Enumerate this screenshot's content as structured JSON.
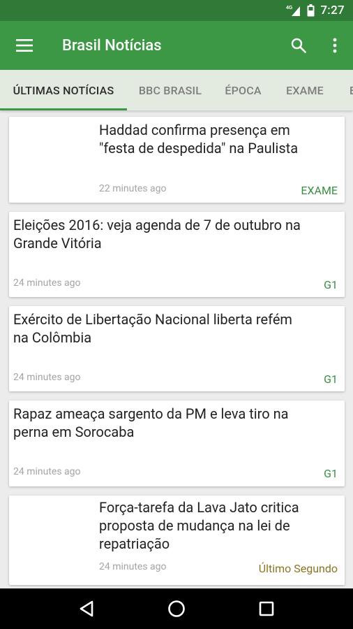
{
  "status": {
    "network": "4G",
    "time": "7:27"
  },
  "appbar": {
    "title": "Brasil Notícias"
  },
  "tabs": [
    "ÚLTIMAS NOTÍCIAS",
    "BBC BRASIL",
    "ÉPOCA",
    "EXAME",
    "E"
  ],
  "articles": [
    {
      "title_lines": [
        "Haddad confirma presença em",
        "\"festa de despedida\" na Paulista"
      ],
      "time": "22 minutes ago",
      "source": "EXAME"
    },
    {
      "title_lines": [
        "Eleições 2016: veja agenda de 7 de outubro na",
        "Grande Vitória"
      ],
      "time": "24 minutes ago",
      "source": "G1"
    },
    {
      "title_lines": [
        "Exército de Libertação Nacional  liberta refém",
        "na Colômbia"
      ],
      "time": "24 minutes ago",
      "source": "G1"
    },
    {
      "title_lines": [
        "Rapaz ameaça sargento da PM e leva tiro na",
        "perna em Sorocaba"
      ],
      "time": "24 minutes ago",
      "source": "G1"
    },
    {
      "title_lines": [
        "Força-tarefa da Lava Jato critica",
        "proposta de mudança na lei de",
        "repatriação"
      ],
      "time": "24 minutes ago",
      "source": "Último Segundo"
    }
  ],
  "colors": {
    "primary": "#3c9844",
    "primary_dark": "#2e7a36",
    "tab_bg": "#e3ebe0",
    "source_green": "#3b8f43",
    "source_gold": "#8d7424"
  }
}
